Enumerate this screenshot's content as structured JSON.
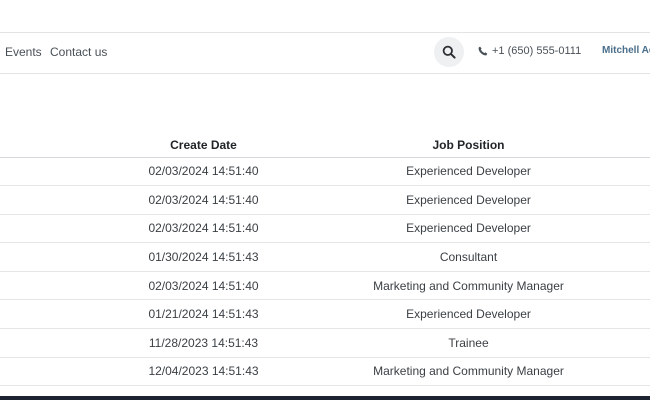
{
  "nav": {
    "events": "Events",
    "contact": "Contact us",
    "phone": "+1 (650) 555-0111",
    "user": "Mitchell Ad"
  },
  "icons": {
    "search": "search-icon",
    "phone": "phone-icon"
  },
  "table": {
    "columns": [
      "Create Date",
      "Job Position"
    ],
    "rows": [
      [
        "02/03/2024 14:51:40",
        "Experienced Developer"
      ],
      [
        "02/03/2024 14:51:40",
        "Experienced Developer"
      ],
      [
        "02/03/2024 14:51:40",
        "Experienced Developer"
      ],
      [
        "01/30/2024 14:51:43",
        "Consultant"
      ],
      [
        "02/03/2024 14:51:40",
        "Marketing and Community Manager"
      ],
      [
        "01/21/2024 14:51:43",
        "Experienced Developer"
      ],
      [
        "11/28/2023 14:51:43",
        "Trainee"
      ],
      [
        "12/04/2023 14:51:43",
        "Marketing and Community Manager"
      ]
    ]
  },
  "colors": {
    "user_link": "#4a6e8a",
    "footer": "#1e2331",
    "search_bg": "#eef0f2"
  }
}
